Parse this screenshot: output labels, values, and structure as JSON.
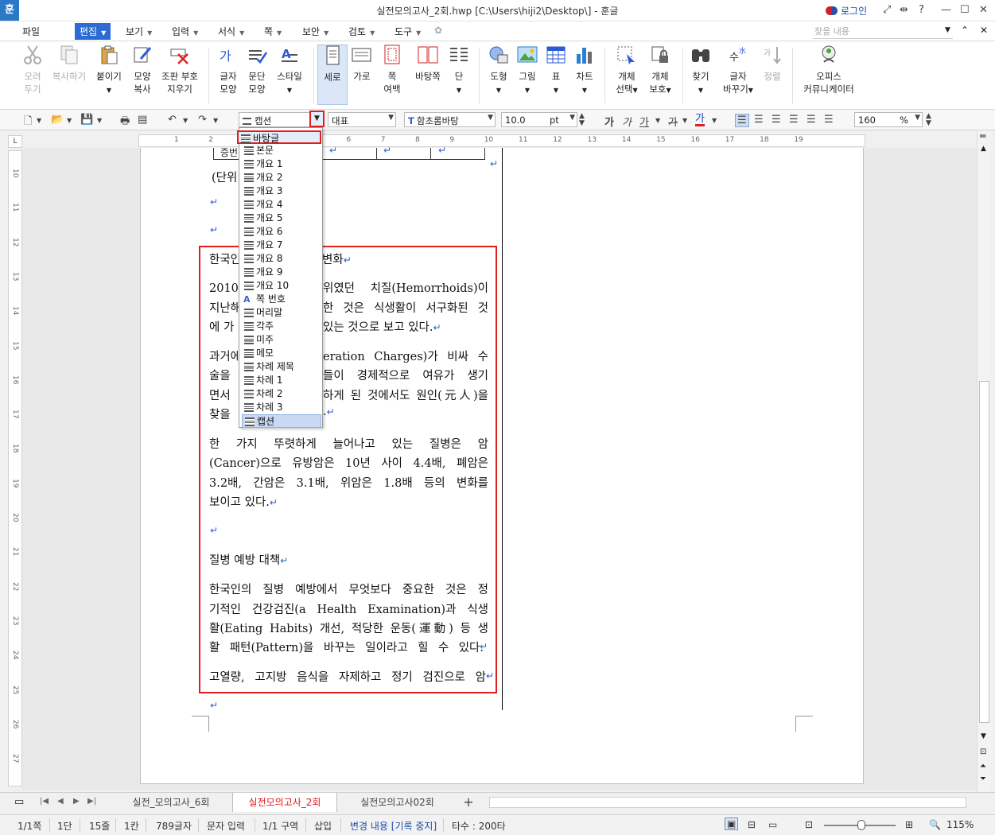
{
  "titlebar": {
    "logo": "훈",
    "title": "실전모의고사_2회.hwp [C:\\Users\\hiji2\\Desktop\\] - 훈글",
    "login": "로그인",
    "help": "?"
  },
  "menu": {
    "items": [
      {
        "label": "파일"
      },
      {
        "label": "편집"
      },
      {
        "label": "보기"
      },
      {
        "label": "입력"
      },
      {
        "label": "서식"
      },
      {
        "label": "쪽"
      },
      {
        "label": "보안"
      },
      {
        "label": "검토"
      },
      {
        "label": "도구"
      }
    ],
    "search_placeholder": "찾을 내용"
  },
  "ribbon": {
    "cut": [
      "오려",
      "두기"
    ],
    "copy": "복사하기",
    "paste": "붙이기",
    "format_copy": [
      "모양",
      "복사"
    ],
    "clear_layout": [
      "조판 부호",
      "지우기"
    ],
    "char_shape": [
      "글자",
      "모양"
    ],
    "para_shape": [
      "문단",
      "모양"
    ],
    "style": "스타일",
    "portrait": "세로",
    "landscape": "가로",
    "page_margin": [
      "쪽",
      "여백"
    ],
    "two_pages": "바탕쪽",
    "columns": "단",
    "shape": "도형",
    "picture": "그림",
    "table": "표",
    "chart": "차트",
    "object_select": [
      "개체",
      "선택"
    ],
    "object_protect": [
      "개체",
      "보호"
    ],
    "find": "찾기",
    "replace": [
      "글자",
      "바꾸기"
    ],
    "sort": "정렬",
    "office_comm": [
      "오피스",
      "커뮤니케이터"
    ]
  },
  "fmtbar": {
    "style_value": "캡션",
    "lang_value": "대표",
    "font_value": "함초롬바탕",
    "size_value": "10.0",
    "size_unit": "pt",
    "bold": "가",
    "italic": "가",
    "underline": "가",
    "strike": "가",
    "color": "가",
    "zoom_value": "160",
    "zoom_unit": "%"
  },
  "ruler": {
    "h_ticks": [
      "1",
      "2",
      "3",
      "4",
      "5",
      "6",
      "7",
      "8",
      "9",
      "10",
      "11",
      "12",
      "13",
      "14",
      "15",
      "16",
      "17",
      "18",
      "19"
    ],
    "v_ticks": [
      "10",
      "11",
      "12",
      "13",
      "14",
      "15",
      "16",
      "17",
      "18",
      "19",
      "20",
      "21",
      "22",
      "23",
      "24",
      "25",
      "26",
      "27"
    ],
    "corner": "L"
  },
  "document": {
    "table_fragment": "증번",
    "unit_line": "(단위",
    "p1_title": "한국인",
    "p1_title_tail": "변화",
    "p2": [
      "2010년",
      "위였던 치질(Hemorrhoids)이",
      "지난해",
      "한 것은 식생활이 서구화된 것",
      "에 가",
      "있는 것으로 보고 있다."
    ],
    "p3": [
      "과거에",
      "eration Charges)가 비싸 수",
      "술을",
      "들이 경제적으로 여유가 생기",
      "면서",
      "하게 된 것에서도 원인(元人)을",
      "찾을",
      "."
    ],
    "p4": [
      "한 가지 뚜렷하게 늘어나고 있는 질병은 암",
      "(Cancer)으로 유방암은 10년 사이 4.4배, 폐암은",
      "3.2배, 간암은 3.1배, 위암은 1.8배 등의 변화를",
      "보이고 있다."
    ],
    "p5": "질병 예방 대책",
    "p6": [
      "한국인의 질병 예방에서 무엇보다 중요한 것은 정",
      "기적인 건강검진(a Health Examination)과 식생",
      "활(Eating Habits) 개선, 적당한 운동(運動) 등 생",
      "활 패턴(Pattern)을 바꾸는 일이라고 힐 수 있다."
    ],
    "p7": "고열량, 고지방 음식을 자제하고 정기 검진으로 암",
    "return_mark": "↵"
  },
  "style_list": {
    "items": [
      {
        "label": "바탕글",
        "icon": "para-style-icon"
      },
      {
        "label": "본문",
        "icon": "para-style-icon"
      },
      {
        "label": "개요 1",
        "icon": "para-style-icon"
      },
      {
        "label": "개요 2",
        "icon": "para-style-icon"
      },
      {
        "label": "개요 3",
        "icon": "para-style-icon"
      },
      {
        "label": "개요 4",
        "icon": "para-style-icon"
      },
      {
        "label": "개요 5",
        "icon": "para-style-icon"
      },
      {
        "label": "개요 6",
        "icon": "para-style-icon"
      },
      {
        "label": "개요 7",
        "icon": "para-style-icon"
      },
      {
        "label": "개요 8",
        "icon": "para-style-icon"
      },
      {
        "label": "개요 9",
        "icon": "para-style-icon"
      },
      {
        "label": "개요 10",
        "icon": "para-style-icon"
      },
      {
        "label": "쪽 번호",
        "icon": "char-style-icon"
      },
      {
        "label": "머리말",
        "icon": "para-style-icon"
      },
      {
        "label": "각주",
        "icon": "para-style-icon"
      },
      {
        "label": "미주",
        "icon": "para-style-icon"
      },
      {
        "label": "메모",
        "icon": "para-style-icon"
      },
      {
        "label": "차례 제목",
        "icon": "para-style-icon"
      },
      {
        "label": "차례 1",
        "icon": "para-style-icon"
      },
      {
        "label": "차례 2",
        "icon": "para-style-icon"
      },
      {
        "label": "차례 3",
        "icon": "para-style-icon"
      },
      {
        "label": "캡션",
        "icon": "para-style-icon"
      }
    ],
    "highlighted": "바탕글",
    "current": "캡션"
  },
  "tabs": {
    "items": [
      {
        "label": "실전_모의고사_6회"
      },
      {
        "label": "실전모의고사_2회"
      },
      {
        "label": "실전모의고사02회"
      }
    ],
    "add": "+"
  },
  "status": {
    "page": "1/1쪽",
    "column": "1단",
    "line": "15줄",
    "col": "1칸",
    "chars": "789글자",
    "mode": "문자 입력",
    "section": "1/1 구역",
    "insert": "삽입",
    "track": "변경 내용 [기록 중지]",
    "typing": "타수 : 200타",
    "zoom": "115%"
  },
  "colors": {
    "accent": "#2b6bd3",
    "highlight": "#e01e1e",
    "active_tab": "#e11b1b",
    "return_mark": "#2a5bd6"
  }
}
